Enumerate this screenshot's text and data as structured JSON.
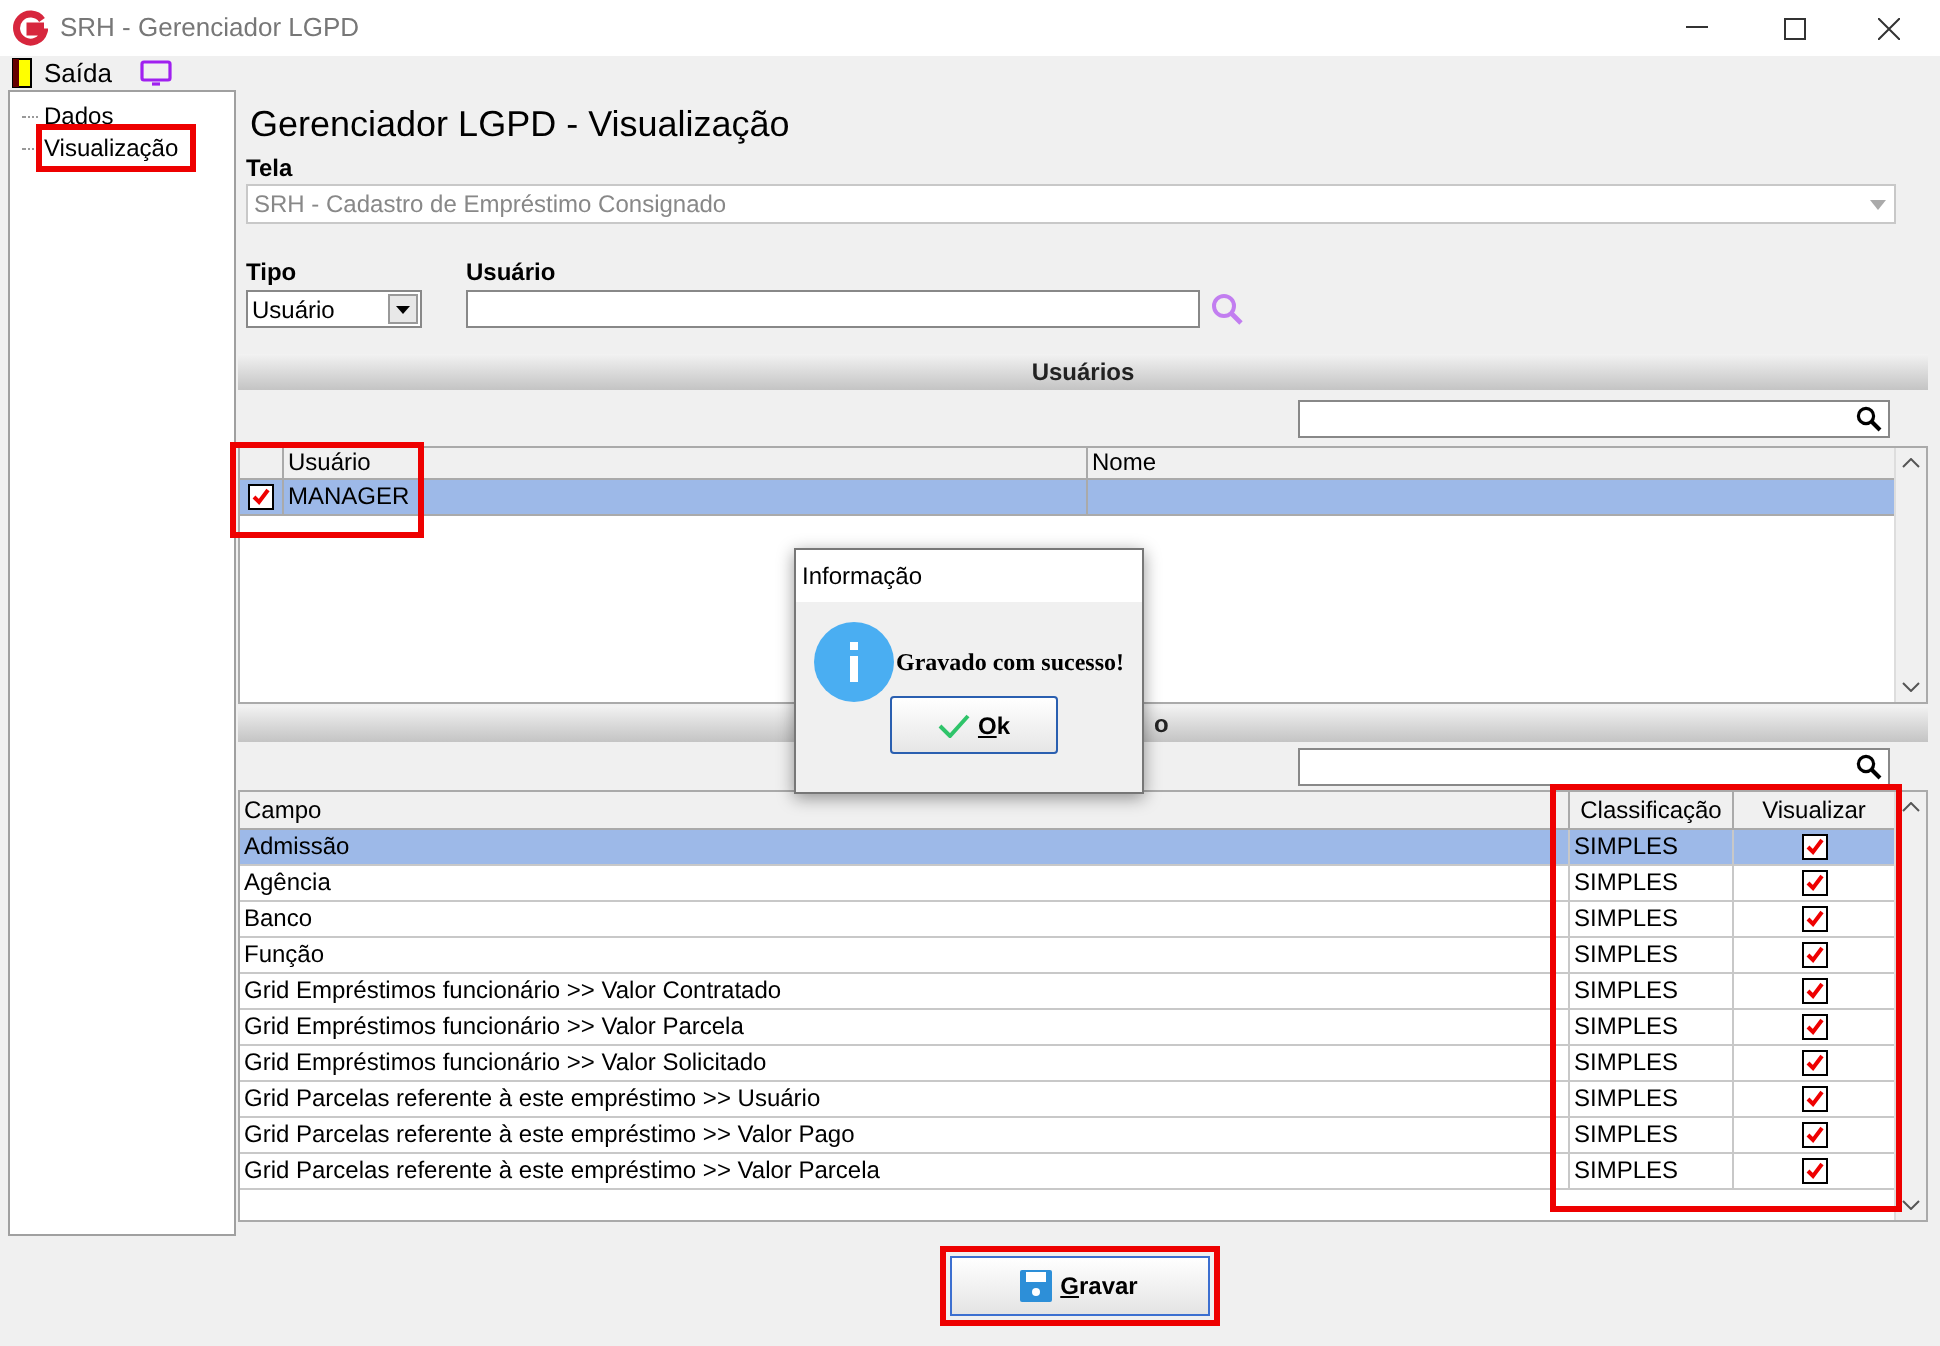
{
  "window": {
    "title": "SRH - Gerenciador LGPD"
  },
  "menu": [
    {
      "kind": "exit",
      "label": "Saída"
    },
    {
      "kind": "screen"
    }
  ],
  "tree": [
    {
      "label": "Dados",
      "selected": false
    },
    {
      "label": "Visualização",
      "selected": true
    }
  ],
  "page_title": "Gerenciador LGPD - Visualização",
  "tela": {
    "label": "Tela",
    "value": "SRH - Cadastro de Empréstimo Consignado"
  },
  "tipo": {
    "label": "Tipo",
    "value": "Usuário"
  },
  "usuario": {
    "label": "Usuário"
  },
  "users_section": {
    "title": "Usuários",
    "columns": [
      "Usuário",
      "Nome"
    ],
    "rows": [
      {
        "checked": true,
        "usuario": "MANAGER",
        "selected": true
      }
    ]
  },
  "fields_section": {
    "title": "o",
    "columns": [
      "Campo",
      "Classificação",
      "Visualizar"
    ],
    "rows": [
      {
        "campo": "Admissão",
        "classificacao": "SIMPLES",
        "visualizar": true,
        "selected": true
      },
      {
        "campo": "Agência",
        "classificacao": "SIMPLES",
        "visualizar": true,
        "selected": false
      },
      {
        "campo": "Banco",
        "classificacao": "SIMPLES",
        "visualizar": true,
        "selected": false
      },
      {
        "campo": "Função",
        "classificacao": "SIMPLES",
        "visualizar": true,
        "selected": false
      },
      {
        "campo": "Grid Empréstimos funcionário >> Valor Contratado",
        "classificacao": "SIMPLES",
        "visualizar": true,
        "selected": false
      },
      {
        "campo": "Grid Empréstimos funcionário >> Valor Parcela",
        "classificacao": "SIMPLES",
        "visualizar": true,
        "selected": false
      },
      {
        "campo": "Grid Empréstimos funcionário >> Valor Solicitado",
        "classificacao": "SIMPLES",
        "visualizar": true,
        "selected": false
      },
      {
        "campo": "Grid Parcelas referente à este empréstimo >> Usuário",
        "classificacao": "SIMPLES",
        "visualizar": true,
        "selected": false
      },
      {
        "campo": "Grid Parcelas referente à este empréstimo >> Valor Pago",
        "classificacao": "SIMPLES",
        "visualizar": true,
        "selected": false
      },
      {
        "campo": "Grid Parcelas referente à este empréstimo >> Valor Parcela",
        "classificacao": "SIMPLES",
        "visualizar": true,
        "selected": false
      }
    ]
  },
  "save_button": {
    "label": "Gravar"
  },
  "dialog": {
    "title": "Informação",
    "message": "Gravado com sucesso!",
    "button": "Ok"
  }
}
